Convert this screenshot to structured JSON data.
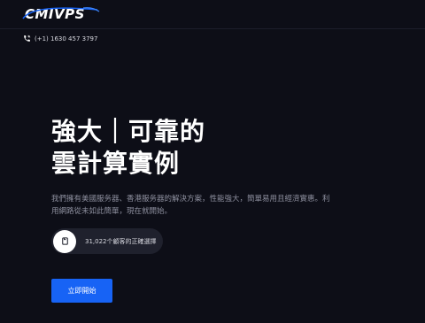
{
  "header": {
    "logo_text": "CMIVPS",
    "phone": "(+1) 1630 457 3797"
  },
  "hero": {
    "title_line1": "強大｜可靠的",
    "title_line2": "雲計算實例",
    "description_line1": "我們擁有美國服务器、香港服务器的解決方案，性能強大，簡單易用且經濟實惠。利",
    "description_line2": "用網路從未如此簡單，現在就開始。",
    "stats_text": "31,022个顧客的正確選擇",
    "cta_label": "立即開始"
  },
  "colors": {
    "background": "#0d0e17",
    "accent": "#1763f5",
    "pill": "#1f212d",
    "muted_text": "#8d8f9e"
  },
  "icons": {
    "phone": "phone-icon",
    "stats": "copy-icon"
  }
}
